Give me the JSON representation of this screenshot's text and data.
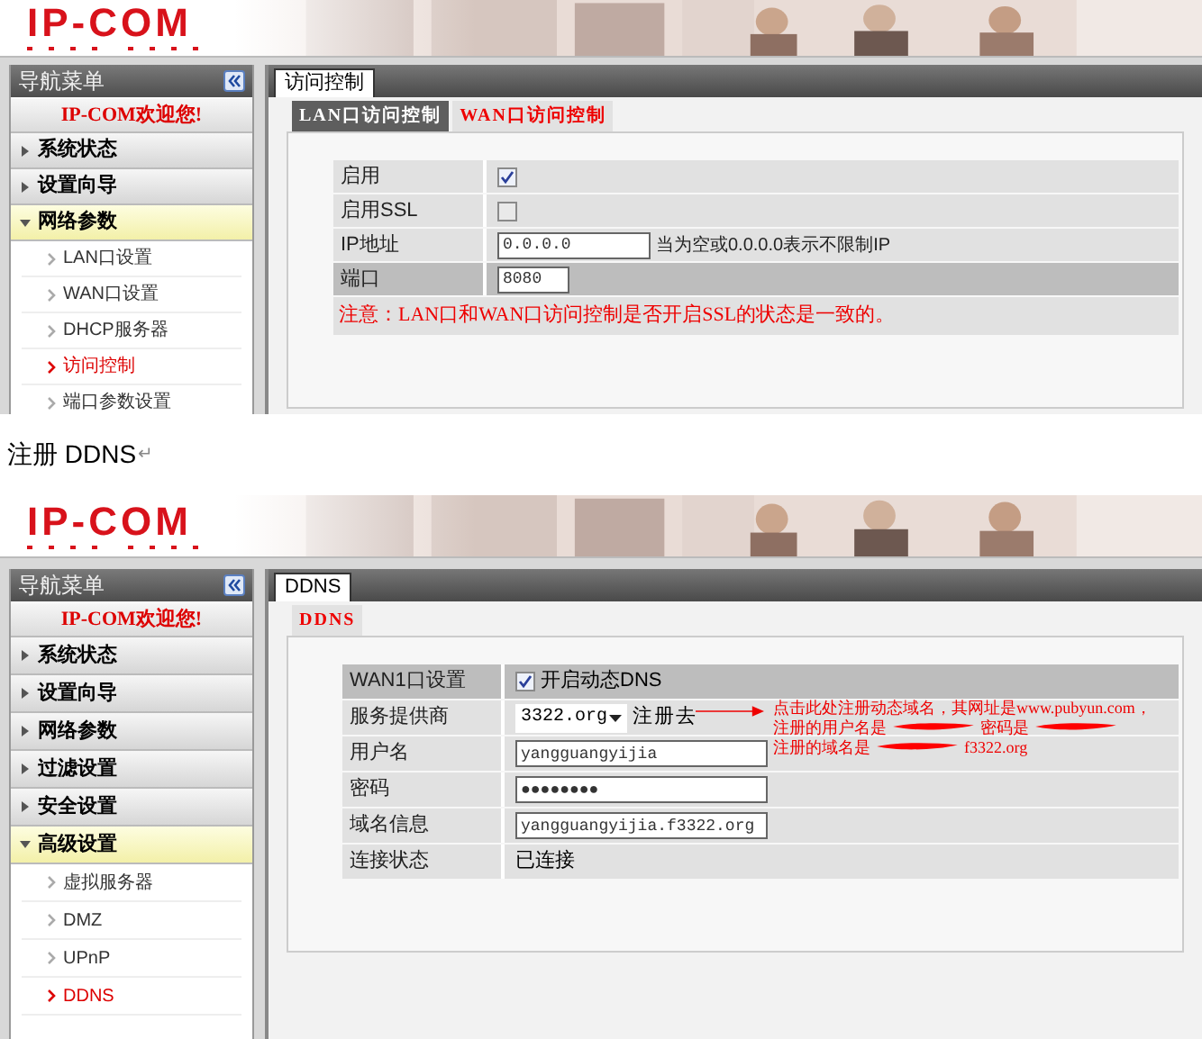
{
  "blocks": [
    {
      "kind": "screenshot",
      "logo": "IP-COM",
      "nav_title": "导航菜单",
      "welcome": "IP-COM欢迎您!",
      "menu": [
        {
          "label": "系统状态",
          "expanded": false
        },
        {
          "label": "设置向导",
          "expanded": false
        },
        {
          "label": "网络参数",
          "expanded": true,
          "children": [
            {
              "label": "LAN口设置",
              "selected": false
            },
            {
              "label": "WAN口设置",
              "selected": false
            },
            {
              "label": "DHCP服务器",
              "selected": false
            },
            {
              "label": "访问控制",
              "selected": true
            },
            {
              "label": "端口参数设置",
              "selected": false
            }
          ]
        }
      ],
      "tab": "访问控制",
      "subtabs": [
        {
          "label": "LAN口访问控制",
          "selected": false
        },
        {
          "label": "WAN口访问控制",
          "selected": true
        }
      ],
      "rows": [
        {
          "kind": "checkbox",
          "label": "启用",
          "checked": true,
          "highlighted": false
        },
        {
          "kind": "checkbox",
          "label": "启用SSL",
          "checked": false,
          "highlighted": false
        },
        {
          "kind": "input",
          "label": "IP地址",
          "value": "0.0.0.0",
          "hint": "当为空或0.0.0.0表示不限制IP",
          "highlighted": false
        },
        {
          "kind": "input",
          "label": "端口",
          "value": "8080",
          "highlighted": true
        },
        {
          "kind": "note",
          "text": "注意：LAN口和WAN口访问控制是否开启SSL的状态是一致的。"
        }
      ]
    },
    {
      "kind": "caption",
      "text": "注册 DDNS",
      "mark": "↵"
    },
    {
      "kind": "screenshot",
      "logo": "IP-COM",
      "nav_title": "导航菜单",
      "welcome": "IP-COM欢迎您!",
      "menu": [
        {
          "label": "系统状态",
          "expanded": false
        },
        {
          "label": "设置向导",
          "expanded": false
        },
        {
          "label": "网络参数",
          "expanded": false
        },
        {
          "label": "过滤设置",
          "expanded": false
        },
        {
          "label": "安全设置",
          "expanded": false
        },
        {
          "label": "高级设置",
          "expanded": true,
          "children": [
            {
              "label": "虚拟服务器",
              "selected": false
            },
            {
              "label": "DMZ",
              "selected": false
            },
            {
              "label": "UPnP",
              "selected": false
            },
            {
              "label": "DDNS",
              "selected": true
            }
          ]
        }
      ],
      "tab": "DDNS",
      "subtabs": [
        {
          "label": "DDNS",
          "selected": true
        }
      ],
      "rows": [
        {
          "kind": "checkbox",
          "label": "WAN1口设置",
          "checked": true,
          "text": "开启动态DNS",
          "highlighted": true
        },
        {
          "kind": "select",
          "label": "服务提供商",
          "value": "3322.org",
          "link": "注册去",
          "highlighted": false
        },
        {
          "kind": "input",
          "label": "用户名",
          "value": "yangguangyijia",
          "highlighted": false
        },
        {
          "kind": "input",
          "label": "密码",
          "value": "●●●●●●●●",
          "highlighted": false
        },
        {
          "kind": "input",
          "label": "域名信息",
          "value": "yangguangyijia.f3322.org",
          "highlighted": false
        },
        {
          "kind": "text",
          "label": "连接状态",
          "value": "已连接",
          "highlighted": false
        }
      ],
      "annotation": [
        [
          {
            "kind": "text",
            "text": "点击此处注册动态域名，其网址是www.pubyun.com，"
          }
        ],
        [
          {
            "kind": "text",
            "text": "注册的用户名是"
          },
          {
            "kind": "redaction"
          },
          {
            "kind": "text",
            "text": "密码是"
          },
          {
            "kind": "redaction"
          }
        ],
        [
          {
            "kind": "text",
            "text": "注册的域名是"
          },
          {
            "kind": "redaction"
          },
          {
            "kind": "text",
            "text": "f3322.org"
          }
        ]
      ]
    }
  ]
}
